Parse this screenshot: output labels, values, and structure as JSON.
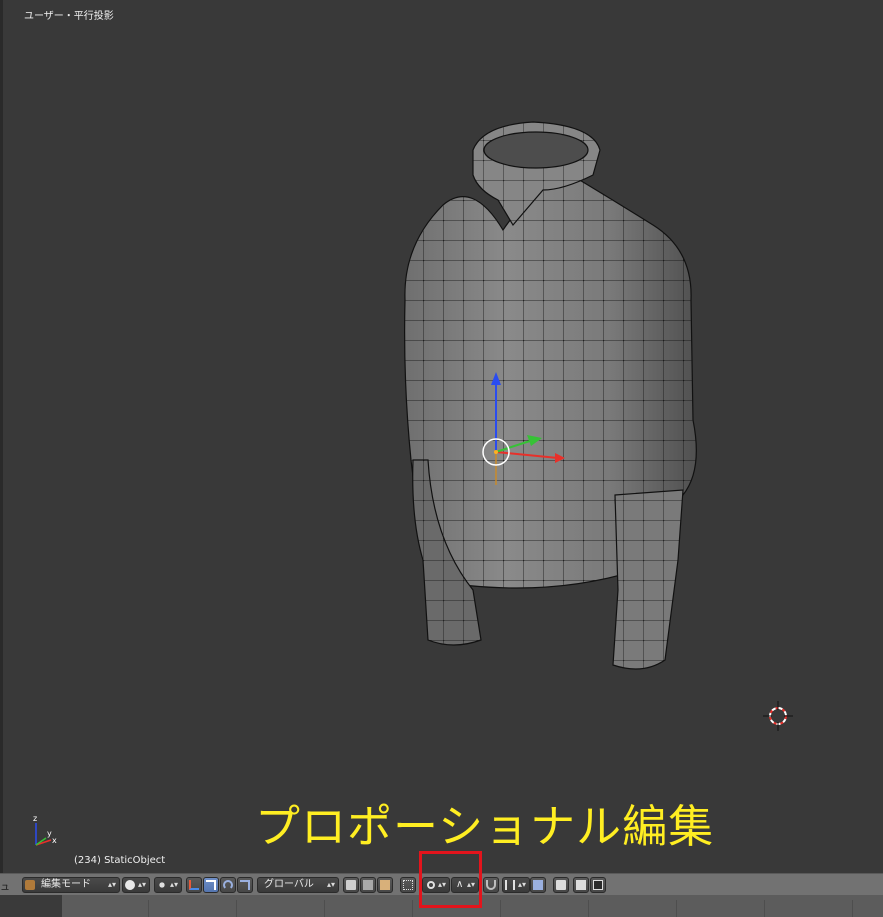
{
  "viewport": {
    "view_label": "ユーザー・平行投影",
    "object_label": "(234) StaticObject",
    "axis_labels": {
      "z": "z",
      "x": "x",
      "y": "y"
    }
  },
  "annotation": {
    "text": "プロポーショナル編集",
    "color": "#ffee22"
  },
  "header": {
    "menu_stub": "ュ",
    "mode_label": "編集モード",
    "orientation_label": "グローバル",
    "proportional_falloff_symbol": "∧",
    "icons": {
      "mode": "cube-mode-icon",
      "pivot": "pivot-point-icon",
      "shading": "viewport-shading-icon",
      "manipulator": "manipulator-icon",
      "translate": "translate-icon",
      "rotate": "rotate-icon",
      "scale": "scale-icon",
      "vertex_select": "vertex-select-icon",
      "edge_select": "edge-select-icon",
      "face_select": "face-select-icon",
      "occlude": "occlude-geometry-icon",
      "proportional": "proportional-edit-icon",
      "falloff": "falloff-curve-icon",
      "snap": "snap-magnet-icon",
      "snap_target": "snap-target-icon",
      "render_preview": "opengl-render-icon",
      "render_anim": "opengl-render-animation-icon"
    }
  },
  "colors": {
    "highlight_box": "#e3141c",
    "axis_x": "#e8302a",
    "axis_y": "#36c236",
    "axis_z": "#2a4cf0",
    "active_button": "#5475b0"
  }
}
